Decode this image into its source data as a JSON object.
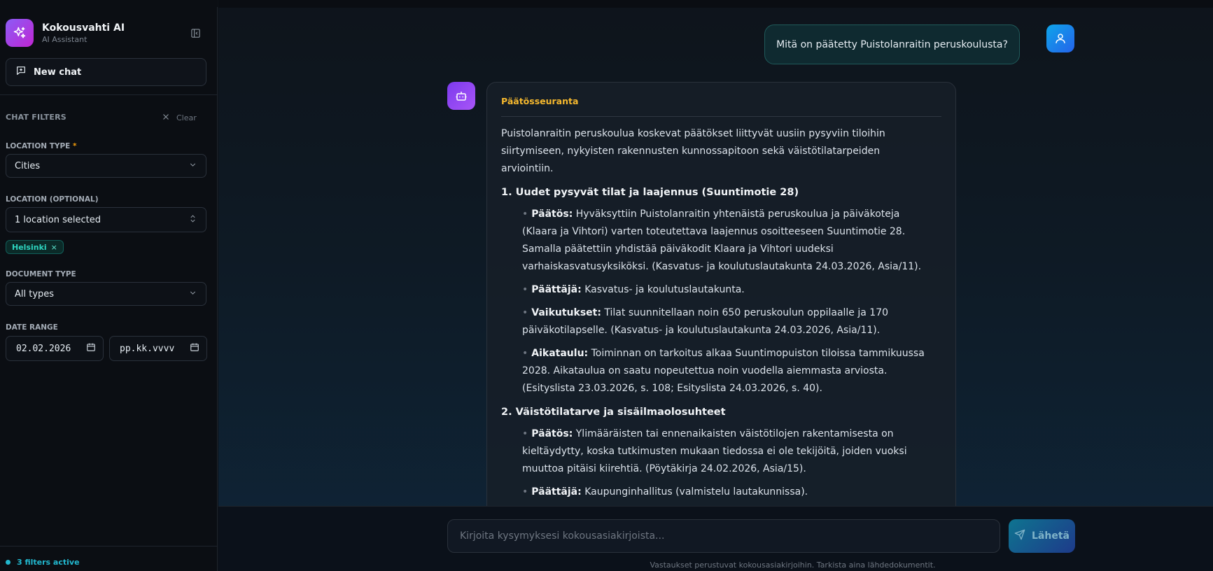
{
  "sidebar": {
    "brand_name": "Kokousvahti AI",
    "brand_sub": "AI Assistant",
    "new_chat": "New chat",
    "filters_title": "CHAT FILTERS",
    "clear": "Clear",
    "location_type_label": "LOCATION TYPE",
    "location_type_required": "*",
    "location_type_value": "Cities",
    "location_label": "LOCATION (OPTIONAL)",
    "location_value": "1 location selected",
    "location_chip": "Helsinki",
    "location_chip_remove": "×",
    "document_type_label": "DOCUMENT TYPE",
    "document_type_value": "All types",
    "date_range_label": "DATE RANGE",
    "date_from": "02.02.2026",
    "date_to": "pp.kk.vvvv",
    "filters_active": "3 filters active"
  },
  "chat": {
    "user_question": "Mitä on päätetty Puistolanraitin peruskoulusta?",
    "answer_tag": "Päätösseuranta",
    "intro": "Puistolanraitin peruskoulua koskevat päätökset liittyvät uusiin pysyviin tiloihin siirtymiseen, nykyisten rakennusten kunnossapitoon sekä väistötilatarpeiden arviointiin.",
    "sections": [
      {
        "heading": "1. Uudet pysyvät tilat ja laajennus (Suuntimotie 28)",
        "items": [
          {
            "label": "Päätös:",
            "text": "Hyväksyttiin Puistolanraitin yhtenäistä peruskoulua ja päiväkoteja (Klaara ja Vihtori) varten toteutettava laajennus osoitteeseen Suuntimotie 28. Samalla päätettiin yhdistää päiväkodit Klaara ja Vihtori uudeksi varhaiskasvatusyksiköksi. (Kasvatus- ja koulutuslautakunta 24.03.2026, Asia/11)."
          },
          {
            "label": "Päättäjä:",
            "text": "Kasvatus- ja koulutuslautakunta."
          },
          {
            "label": "Vaikutukset:",
            "text": "Tilat suunnitellaan noin 650 peruskoulun oppilaalle ja 170 päiväkotilapselle. (Kasvatus- ja koulutuslautakunta 24.03.2026, Asia/11)."
          },
          {
            "label": "Aikataulu:",
            "text": "Toiminnan on tarkoitus alkaa Suuntimopuiston tiloissa tammikuussa 2028. Aikataulua on saatu nopeutettua noin vuodella aiemmasta arviosta. (Esityslista 23.03.2026, s. 108; Esityslista 24.03.2026, s. 40)."
          }
        ]
      },
      {
        "heading": "2. Väistötilatarve ja sisäilmaolosuhteet",
        "items": [
          {
            "label": "Päätös:",
            "text": "Ylimääräisten tai ennenaikaisten väistötilojen rakentamisesta on kieltäydytty, koska tutkimusten mukaan tiedossa ei ole tekijöitä, joiden vuoksi muuttoa pitäisi kiirehtiä. (Pöytäkirja 24.02.2026, Asia/15)."
          },
          {
            "label": "Päättäjä:",
            "text": "Kaupunginhallitus (valmistelu lautakunnissa)."
          }
        ]
      }
    ]
  },
  "composer": {
    "placeholder": "Kirjoita kysymyksesi kokousasiakirjoista...",
    "send": "Lähetä",
    "disclaimer": "Vastaukset perustuvat kokousasiakirjoihin. Tarkista aina lähdedokumentit."
  },
  "icons": {
    "brand": "sparkles-icon",
    "collapse": "sidebar-collapse-icon",
    "new_chat": "message-plus-icon",
    "clear": "close-icon",
    "chevron": "chevron-down-icon",
    "updown": "chevrons-up-down-icon",
    "calendar": "calendar-icon",
    "user": "user-icon",
    "bot": "bot-icon",
    "send": "send-icon"
  },
  "colors": {
    "accent_cyan": "#22b8cf",
    "tag_amber": "#f5b82e",
    "brand_purple": "#8b5cf6"
  }
}
